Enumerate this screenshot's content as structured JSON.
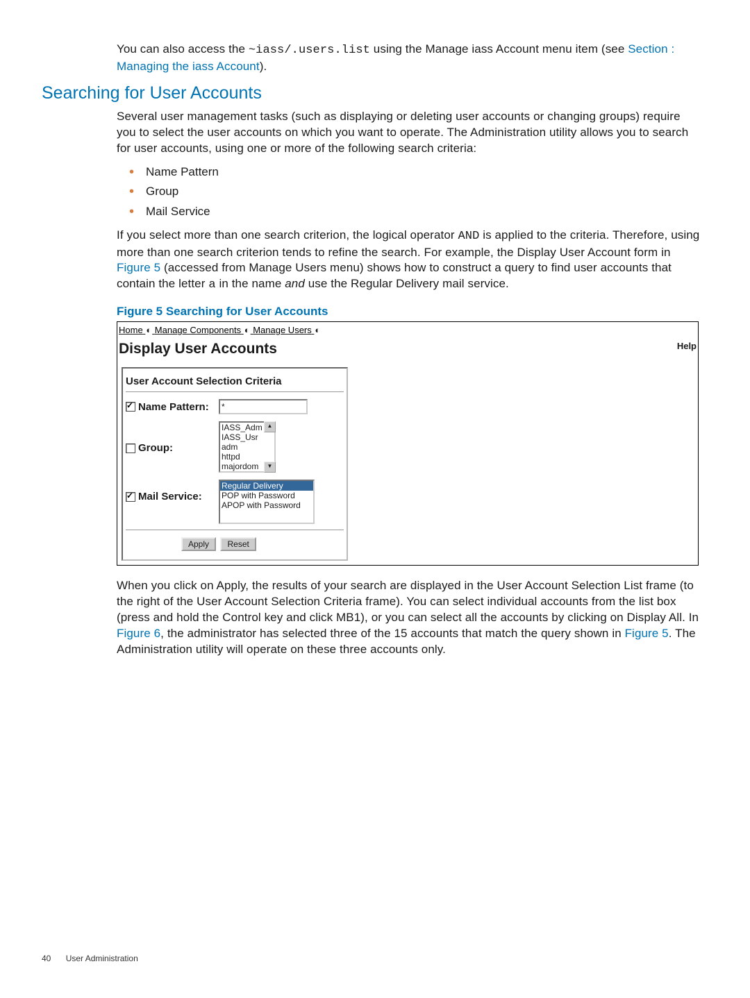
{
  "intro": {
    "text_before": "You can also access the ",
    "code": "~iass/.users.list",
    "text_after": " using the Manage iass Account menu item (see ",
    "link": "Section : Managing the iass Account",
    "close": ")."
  },
  "section_heading": "Searching for User Accounts",
  "para1": "Several user management tasks (such as displaying or deleting user accounts or changing groups) require you to select the user accounts on which you want to operate. The Administration utility allows you to search for user accounts, using one or more of the following search criteria:",
  "criteria_list": [
    "Name Pattern",
    "Group",
    "Mail Service"
  ],
  "para2": {
    "p1": "If you select more than one search criterion, the logical operator ",
    "code1": "AND",
    "p2": " is applied to the criteria. Therefore, using more than one search criterion tends to refine the search. For example, the Display User Account form in ",
    "link1": "Figure 5",
    "p3": " (accessed from Manage Users menu) shows how to construct a query to find user accounts that contain the letter ",
    "code2": "a",
    "p4": " in the name ",
    "em": "and",
    "p5": " use the Regular Delivery mail service."
  },
  "fig_caption": "Figure 5 Searching for User Accounts",
  "screenshot": {
    "breadcrumb": {
      "home": "Home",
      "comp": "Manage Components",
      "users": "Manage Users"
    },
    "title": "Display User Accounts",
    "help": "Help",
    "legend": "User Account Selection Criteria",
    "row1": {
      "label": "Name Pattern:",
      "value": "*"
    },
    "row2": {
      "label": "Group:",
      "options": [
        "IASS_Adm",
        "IASS_Usr",
        "adm",
        "httpd",
        "majordom"
      ]
    },
    "row3": {
      "label": "Mail Service:",
      "options": [
        "Regular Delivery",
        "POP with Password",
        "APOP with Password"
      ]
    },
    "buttons": {
      "apply": "Apply",
      "reset": "Reset"
    }
  },
  "para3": {
    "p1": "When you click on Apply, the results of your search are displayed in the User Account Selection List frame (to the right of the User Account Selection Criteria frame). You can select individual accounts from the list box (press and hold the Control key and click MB1), or you can select all the accounts by clicking on Display All. In ",
    "link1": "Figure 6",
    "p2": ", the administrator has selected three of the 15 accounts that match the query shown in ",
    "link2": "Figure 5",
    "p3": ". The Administration utility will operate on these three accounts only."
  },
  "footer": {
    "page": "40",
    "title": "User Administration"
  }
}
